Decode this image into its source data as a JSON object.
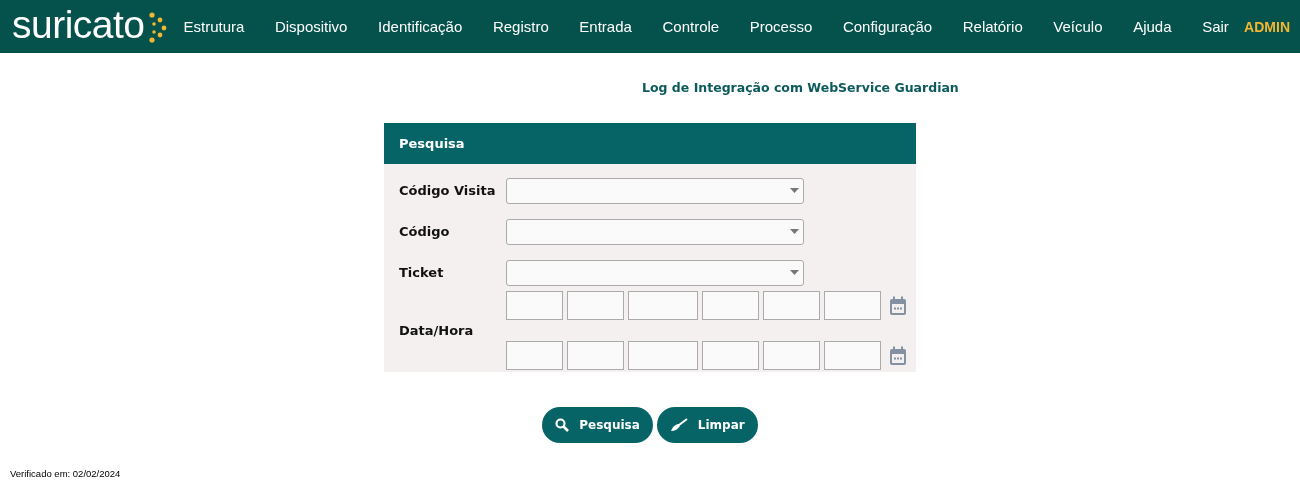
{
  "brand": {
    "name": "suricato"
  },
  "menu": [
    {
      "label": "Estrutura"
    },
    {
      "label": "Dispositivo"
    },
    {
      "label": "Identificação"
    },
    {
      "label": "Registro"
    },
    {
      "label": "Entrada"
    },
    {
      "label": "Controle"
    },
    {
      "label": "Processo"
    },
    {
      "label": "Configuração"
    },
    {
      "label": "Relatório"
    },
    {
      "label": "Veículo"
    },
    {
      "label": "Ajuda"
    },
    {
      "label": "Sair"
    }
  ],
  "user": "ADMIN",
  "page_title": "Log de Integração com WebService Guardian",
  "panel": {
    "title": "Pesquisa",
    "selects": [
      {
        "label": "Código Visita"
      },
      {
        "label": "Código"
      },
      {
        "label": "Ticket"
      }
    ],
    "datetime": {
      "label": "Data/Hora",
      "rows": [
        {
          "parts": [
            {
              "kind": "short"
            },
            {
              "kind": "short"
            },
            {
              "kind": "long"
            },
            {
              "kind": "short"
            },
            {
              "kind": "short"
            },
            {
              "kind": "short"
            }
          ]
        },
        {
          "parts": [
            {
              "kind": "short"
            },
            {
              "kind": "short"
            },
            {
              "kind": "long"
            },
            {
              "kind": "short"
            },
            {
              "kind": "short"
            },
            {
              "kind": "short"
            }
          ]
        }
      ]
    }
  },
  "buttons": [
    {
      "label": "Pesquisa",
      "kind": "search"
    },
    {
      "label": "Limpar",
      "kind": "clear"
    }
  ],
  "footer": "Verificado em: 02/02/2024"
}
